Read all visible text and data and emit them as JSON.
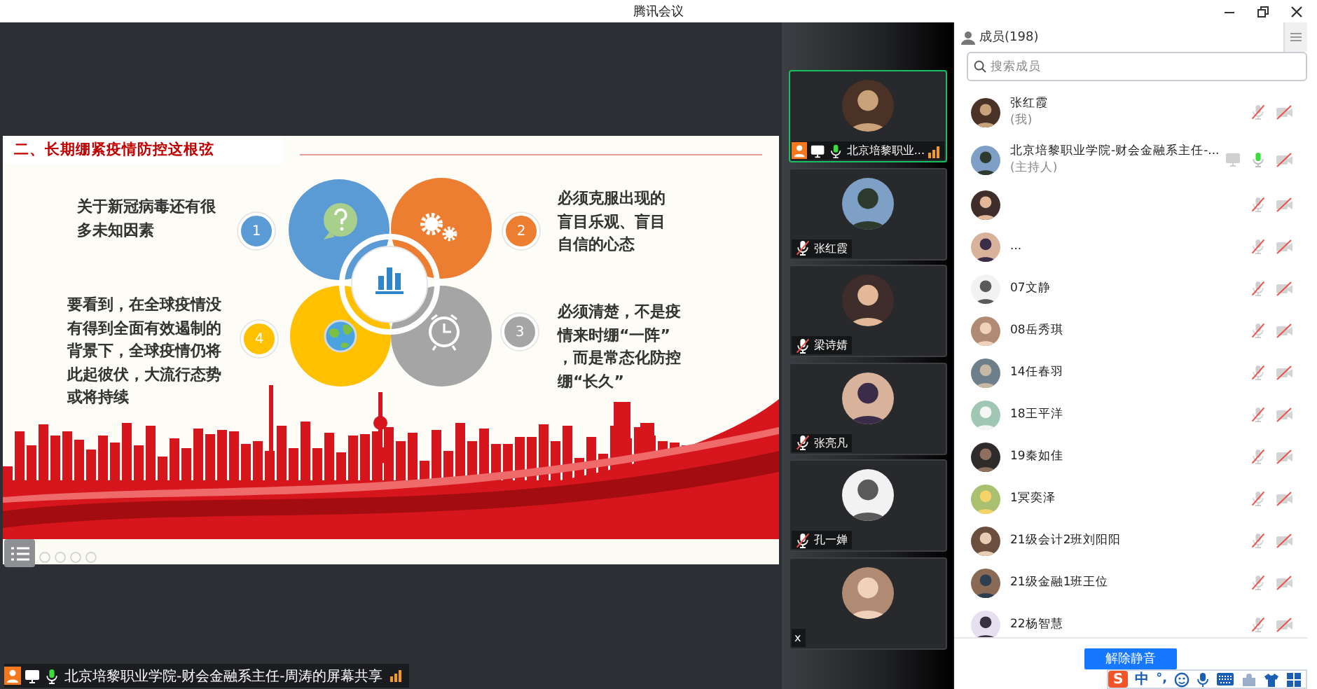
{
  "window": {
    "title": "腾讯会议"
  },
  "slide": {
    "title": "二、长期绷紧疫情防控这根弦",
    "points": [
      {
        "number": "1",
        "text": "关于新冠病毒还有很多未知因素",
        "color": "#5b9bd5"
      },
      {
        "number": "2",
        "text": "必须克服出现的盲目乐观、盲目自信的心态",
        "color": "#ed7d31"
      },
      {
        "number": "4",
        "text": "要看到，在全球疫情没有得到全面有效遏制的背景下，全球疫情仍将此起彼伏，大流行态势或将持续",
        "color": "#ffc000"
      },
      {
        "number": "3",
        "text": "必须清楚，不是疫情来时绷“一阵”，而是常态化防控绷“长久”",
        "color": "#a5a5a5"
      }
    ]
  },
  "share": {
    "label": "北京培黎职业学院-财会金融系主任-周涛的屏幕共享"
  },
  "tiles": [
    {
      "name": "北京培黎职业...",
      "selected": true,
      "muted": false,
      "host": true,
      "sharing": true
    },
    {
      "name": "张红霞",
      "selected": false,
      "muted": true,
      "host": false,
      "sharing": false
    },
    {
      "name": "梁诗婧",
      "selected": false,
      "muted": true,
      "host": false,
      "sharing": false
    },
    {
      "name": "张亮凡",
      "selected": false,
      "muted": true,
      "host": false,
      "sharing": false
    },
    {
      "name": "孔一婵",
      "selected": false,
      "muted": true,
      "host": false,
      "sharing": false
    },
    {
      "name": "x",
      "selected": false,
      "host": false,
      "sharing": false
    }
  ],
  "members": {
    "title": "成员(198)",
    "search": {
      "placeholder": "搜索成员"
    },
    "rows": [
      {
        "name": "张红霞",
        "note": "(我)",
        "muted": true,
        "camera_on": false,
        "sharing": false
      },
      {
        "name": "北京培黎职业学院-财会金融系主任-...",
        "note": "(主持人)",
        "muted": false,
        "camera_on": false,
        "sharing": true
      },
      {
        "muted": true,
        "camera_on": false,
        "sharing": false
      },
      {
        "name": "...",
        "muted": true,
        "camera_on": false,
        "sharing": false
      },
      {
        "name": "07文静",
        "muted": true,
        "camera_on": false,
        "sharing": false
      },
      {
        "name": "08岳秀琪",
        "muted": true,
        "camera_on": false,
        "sharing": false
      },
      {
        "name": "14任春羽",
        "muted": true,
        "camera_on": false,
        "sharing": false
      },
      {
        "name": "18王平洋",
        "muted": true,
        "camera_on": false,
        "sharing": false
      },
      {
        "name": "19秦如佳",
        "muted": true,
        "camera_on": false,
        "sharing": false
      },
      {
        "name": "1冥奕泽",
        "muted": true,
        "camera_on": false,
        "sharing": false
      },
      {
        "name": "21级会计2班刘阳阳",
        "muted": true,
        "camera_on": false,
        "sharing": false
      },
      {
        "name": "21级金融1班王位",
        "muted": true,
        "camera_on": false,
        "sharing": false
      },
      {
        "name": "22杨智慧",
        "muted": true,
        "camera_on": false,
        "sharing": false
      }
    ],
    "button": "解除静音"
  },
  "ime": {
    "logo": "S",
    "mode": "中",
    "punctuation": "°,"
  }
}
